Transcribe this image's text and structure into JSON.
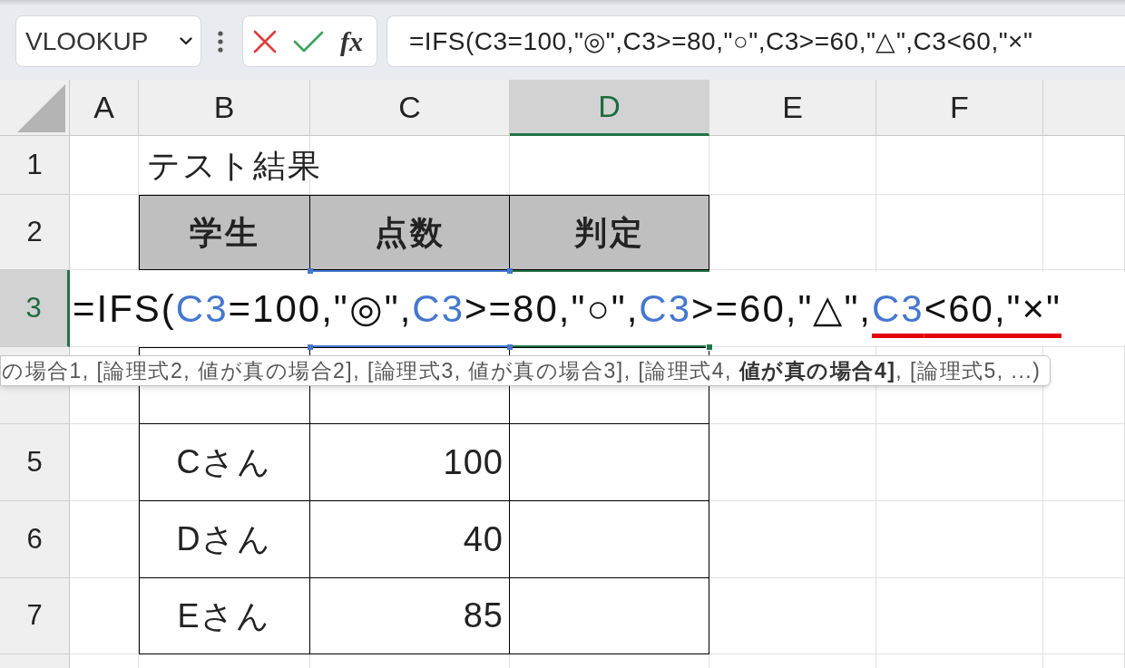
{
  "toolbar": {
    "name_box": {
      "value": "VLOOKUP"
    },
    "function_label": "fx",
    "formula": "=IFS(C3=100,\"◎\",C3>=80,\"○\",C3>=60,\"△\",C3<60,\"×\""
  },
  "sheet": {
    "columns": [
      {
        "label": "A",
        "selected": false,
        "referenced": false
      },
      {
        "label": "B",
        "selected": false,
        "referenced": false
      },
      {
        "label": "C",
        "selected": false,
        "referenced": true
      },
      {
        "label": "D",
        "selected": true,
        "referenced": false
      },
      {
        "label": "E",
        "selected": false,
        "referenced": false
      },
      {
        "label": "F",
        "selected": false,
        "referenced": false
      }
    ],
    "rows": [
      {
        "label": "1",
        "selected": false,
        "kind": "title",
        "title": "テスト結果"
      },
      {
        "label": "2",
        "selected": false,
        "kind": "header",
        "cells": [
          "学生",
          "点数",
          "判定"
        ]
      },
      {
        "label": "3",
        "selected": true,
        "kind": "editing",
        "segments": [
          {
            "text": "=IFS(",
            "kind": "plain",
            "underlined": false
          },
          {
            "text": "C3",
            "kind": "ref",
            "underlined": false
          },
          {
            "text": "=100,\"◎\",",
            "kind": "plain",
            "underlined": false
          },
          {
            "text": "C3",
            "kind": "ref",
            "underlined": false
          },
          {
            "text": ">=80,\"○\",",
            "kind": "plain",
            "underlined": false
          },
          {
            "text": "C3",
            "kind": "ref",
            "underlined": false
          },
          {
            "text": ">=60,\"△\",",
            "kind": "plain",
            "underlined": false
          },
          {
            "text": "C3",
            "kind": "ref",
            "underlined": true
          },
          {
            "text": "<60,\"×\"",
            "kind": "plain",
            "underlined": true
          }
        ]
      },
      {
        "selected": false,
        "kind": "data"
      },
      {
        "label": "5",
        "selected": false,
        "kind": "data",
        "cells": [
          "Cさん",
          "100"
        ]
      },
      {
        "label": "6",
        "selected": false,
        "kind": "data",
        "cells": [
          "Dさん",
          "40"
        ]
      },
      {
        "label": "7",
        "selected": false,
        "kind": "data",
        "cells": [
          "Eさん",
          "85"
        ]
      }
    ]
  },
  "tooltip": {
    "text": "の場合1, [論理式2, 値が真の場合2], [論理式3, 値が真の場合3], [論理式4, **値が真の場合4]**, [論理式5, ...)"
  }
}
